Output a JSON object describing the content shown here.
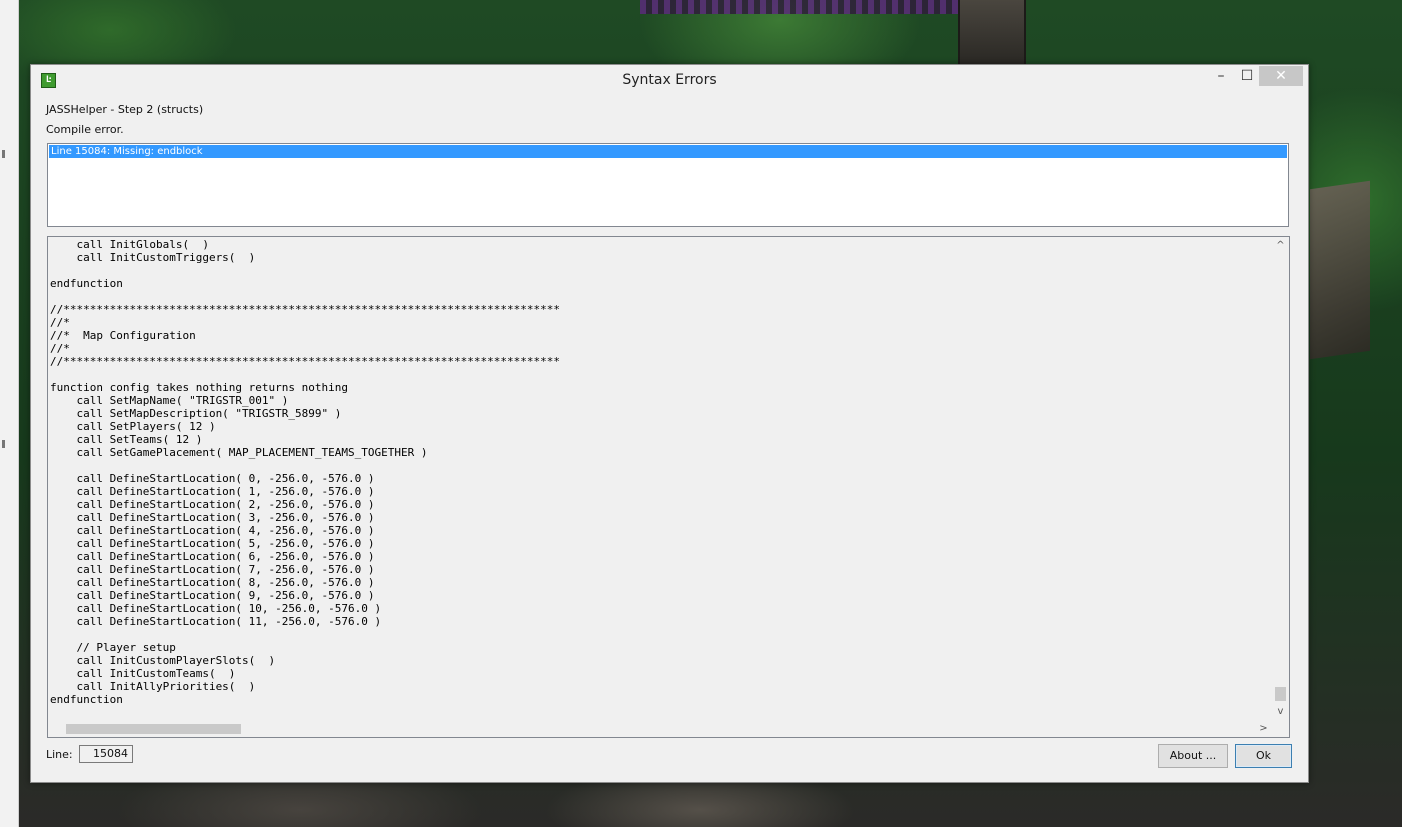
{
  "window": {
    "title": "Syntax Errors",
    "icon_glyph": "Ŀ",
    "controls": {
      "minimize": "–",
      "maximize": "☐",
      "close": "✕"
    }
  },
  "header": {
    "step": "JASSHelper - Step 2 (structs)",
    "status": "Compile error."
  },
  "errors": [
    "Line 15084: Missing: endblock"
  ],
  "code_lines": [
    "    call InitGlobals(  )",
    "    call InitCustomTriggers(  )",
    "",
    "endfunction",
    "",
    "//***************************************************************************",
    "//*",
    "//*  Map Configuration",
    "//*",
    "//***************************************************************************",
    "",
    "function config takes nothing returns nothing",
    "    call SetMapName( \"TRIGSTR_001\" )",
    "    call SetMapDescription( \"TRIGSTR_5899\" )",
    "    call SetPlayers( 12 )",
    "    call SetTeams( 12 )",
    "    call SetGamePlacement( MAP_PLACEMENT_TEAMS_TOGETHER )",
    "",
    "    call DefineStartLocation( 0, -256.0, -576.0 )",
    "    call DefineStartLocation( 1, -256.0, -576.0 )",
    "    call DefineStartLocation( 2, -256.0, -576.0 )",
    "    call DefineStartLocation( 3, -256.0, -576.0 )",
    "    call DefineStartLocation( 4, -256.0, -576.0 )",
    "    call DefineStartLocation( 5, -256.0, -576.0 )",
    "    call DefineStartLocation( 6, -256.0, -576.0 )",
    "    call DefineStartLocation( 7, -256.0, -576.0 )",
    "    call DefineStartLocation( 8, -256.0, -576.0 )",
    "    call DefineStartLocation( 9, -256.0, -576.0 )",
    "    call DefineStartLocation( 10, -256.0, -576.0 )",
    "    call DefineStartLocation( 11, -256.0, -576.0 )",
    "",
    "    // Player setup",
    "    call InitCustomPlayerSlots(  )",
    "    call InitCustomTeams(  )",
    "    call InitAllyPriorities(  )",
    "endfunction"
  ],
  "footer": {
    "line_label": "Line:",
    "line_value": "15084",
    "about_label": "About ...",
    "ok_label": "Ok"
  },
  "scroll": {
    "up": "^",
    "down": "v",
    "right": ">"
  }
}
